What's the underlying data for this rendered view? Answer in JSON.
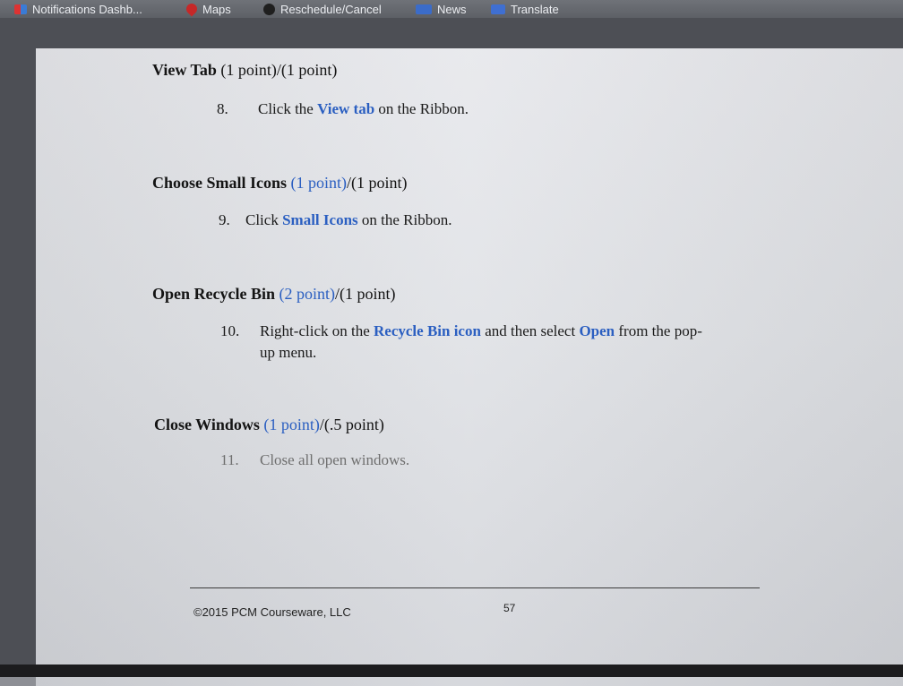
{
  "bookmarks": [
    {
      "label": "Notifications Dashb...",
      "icon": "notifications-icon"
    },
    {
      "label": "Maps",
      "icon": "maps-pin-icon"
    },
    {
      "label": "Reschedule/Cancel",
      "icon": "reschedule-icon"
    },
    {
      "label": "News",
      "icon": "news-icon"
    },
    {
      "label": "Translate",
      "icon": "translate-icon"
    }
  ],
  "sections": [
    {
      "title": "View Tab",
      "points_earned": "(1 point)",
      "points_sep": "/",
      "points_total": "(1 point)",
      "step_number": "8.",
      "step_text_before": "Click the ",
      "step_highlight": "View tab",
      "step_text_after": " on the Ribbon."
    },
    {
      "title": "Choose Small Icons",
      "points_earned": "(1 point)",
      "points_sep": "/",
      "points_total": "(1 point)",
      "step_number": "9.",
      "step_text_before": "Click ",
      "step_highlight": "Small Icons",
      "step_text_after": " on the Ribbon."
    },
    {
      "title": "Open Recycle Bin",
      "points_earned": "(2 point)",
      "points_sep": "/",
      "points_total": "(1 point)",
      "step_number": "10.",
      "step_text_before": "Right-click on the ",
      "step_highlight": "Recycle Bin icon",
      "step_text_middle": " and then select ",
      "step_highlight_2": "Open",
      "step_text_after": " from the pop-",
      "step_text_line2": "up menu."
    },
    {
      "title": "Close Windows",
      "points_earned": "(1 point)",
      "points_sep": "/",
      "points_total": "(.5 point)",
      "step_number": "11.",
      "step_text": "Close all open windows."
    }
  ],
  "footer": {
    "copyright": "©2015 PCM Courseware, LLC",
    "page_number": "57"
  }
}
